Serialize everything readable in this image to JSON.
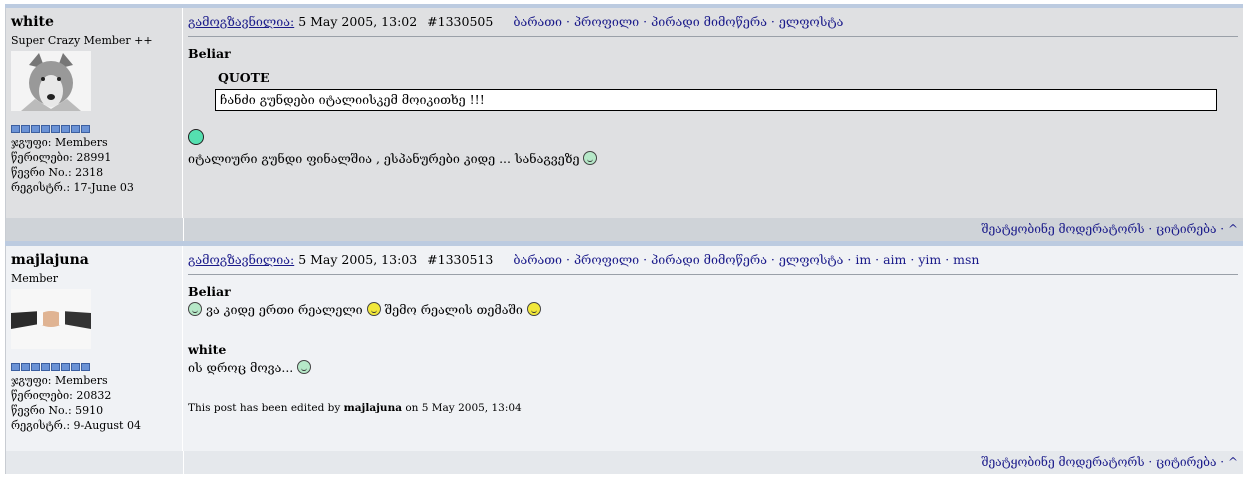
{
  "posts": [
    {
      "username": "white",
      "title": "Super Crazy Member ++",
      "group": "ჯგუფი: Members",
      "messages": "წერილები: 28991",
      "member_no": "წევრი No.: 2318",
      "registered": "რეგისტრ.: 17-June 03",
      "posted_label": "გამოგზავნილია:",
      "date": "5 May 2005, 13:02",
      "post_id": "#1330505",
      "nav": "ბარათი · პროფილი · პირადი მიმოწერა · ელფოსტა",
      "quote_author": "Beliar",
      "quote_label": "QUOTE",
      "quote_text": "ჩანძი გუნდები იტალიისკემ მოიკითხე !!!",
      "message": "იტალიური გუნდი ფინალშია , ესპანურები კიდე ... სანაგვეზე",
      "footer": "შეატყობინე მოდერატორს · ციტირება · ^"
    },
    {
      "username": "majlajuna",
      "title": "Member",
      "group": "ჯგუფი: Members",
      "messages": "წერილები: 20832",
      "member_no": "წევრი No.: 5910",
      "registered": "რეგისტრ.: 9-August 04",
      "posted_label": "გამოგზავნილია:",
      "date": "5 May 2005, 13:03",
      "post_id": "#1330513",
      "nav": "ბარათი · პროფილი · პირადი მიმოწერა · ელფოსტა · im · aim · yim · msn",
      "quote1_author": "Beliar",
      "quote1_text_a": "ვა კიდე ერთი რეალელი",
      "quote1_text_b": "შემო რეალის თემაში",
      "quote2_author": "white",
      "quote2_text": "ის დროც მოვა...",
      "edited_prefix": "This post has been edited by",
      "edited_user": "majlajuna",
      "edited_suffix": "on 5 May 2005, 13:04",
      "footer": "შეატყობინე მოდერატორს · ციტირება · ^"
    }
  ]
}
